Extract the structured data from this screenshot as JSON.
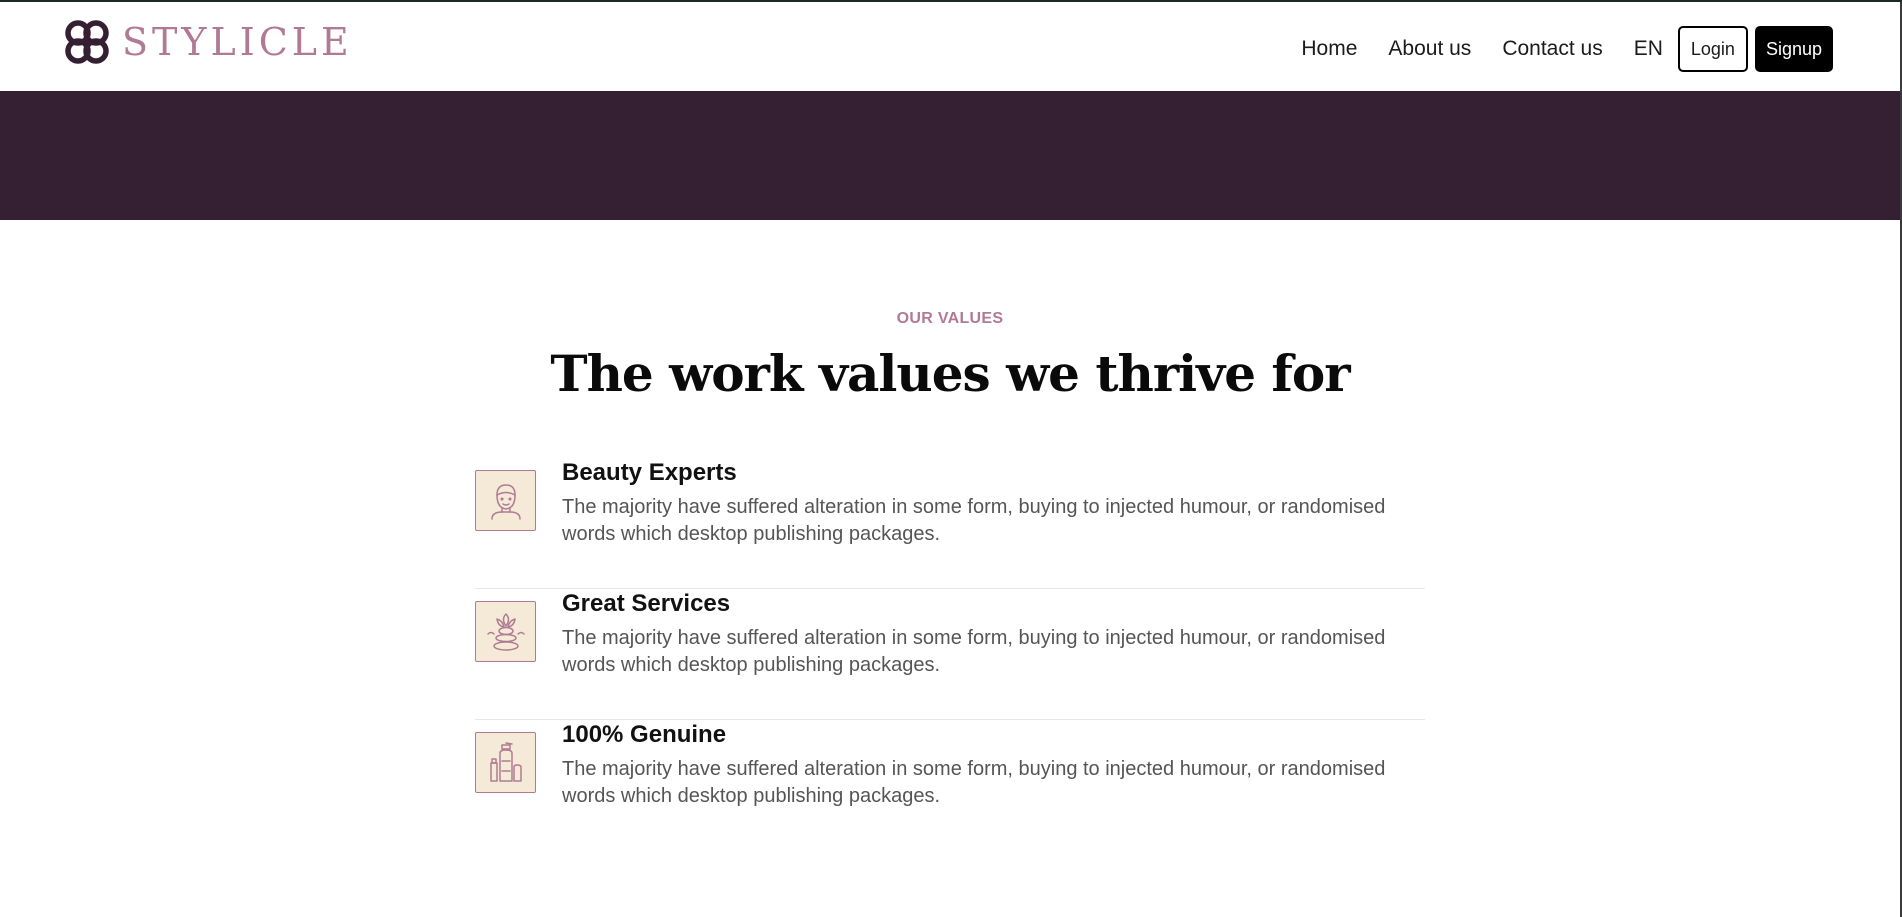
{
  "header": {
    "brand": "STYLICLE",
    "nav": {
      "home": "Home",
      "about": "About us",
      "contact": "Contact us",
      "language": "EN",
      "login": "Login",
      "signup": "Signup"
    }
  },
  "values": {
    "eyebrow": "OUR VALUES",
    "title": "The work values we thrive for",
    "items": [
      {
        "title": "Beauty Experts",
        "description": "The majority have suffered alteration in some form, buying to injected humour, or randomised words which desktop publishing packages.",
        "icon": "beauty-expert-icon"
      },
      {
        "title": "Great Services",
        "description": "The majority have suffered alteration in some form, buying to injected humour, or randomised words which desktop publishing packages.",
        "icon": "spa-stones-icon"
      },
      {
        "title": "100% Genuine",
        "description": "The majority have suffered alteration in some form, buying to injected humour, or randomised words which desktop publishing packages.",
        "icon": "cosmetic-bottles-icon"
      }
    ]
  },
  "colors": {
    "brand": "#b07a94",
    "band": "#351f33",
    "icon_bg": "#f5ead8",
    "text": "#555555"
  }
}
